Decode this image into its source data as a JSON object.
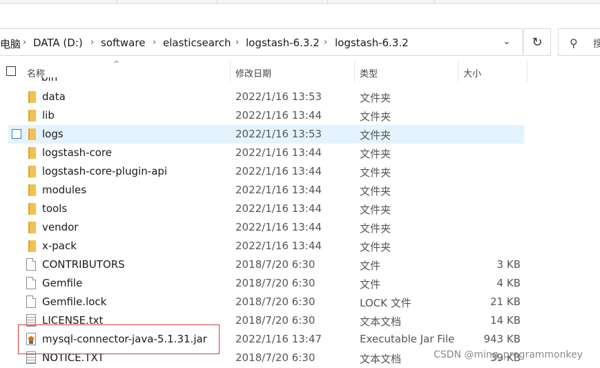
{
  "address_bar": {
    "crumbs": [
      "电脑",
      "DATA (D:)",
      "software",
      "elasticsearch",
      "logstash-6.3.2",
      "logstash-6.3.2"
    ],
    "separator": "›",
    "dropdown_icon": "chevron-down-icon"
  },
  "refresh": {
    "icon": "refresh-icon",
    "glyph": "↻"
  },
  "search": {
    "icon": "search-icon",
    "glyph": "⚲",
    "placeholder": "搜"
  },
  "columns": {
    "name": "名称",
    "date": "修改日期",
    "type": "类型",
    "size": "大小",
    "sort_glyph": "^"
  },
  "partial_row_name": "bin",
  "files": [
    {
      "name": "data",
      "date": "2022/1/16 13:53",
      "type": "文件夹",
      "size": "",
      "icon": "folder-icon"
    },
    {
      "name": "lib",
      "date": "2022/1/16 13:44",
      "type": "文件夹",
      "size": "",
      "icon": "folder-icon"
    },
    {
      "name": "logs",
      "date": "2022/1/16 13:53",
      "type": "文件夹",
      "size": "",
      "icon": "folder-icon",
      "selected": true
    },
    {
      "name": "logstash-core",
      "date": "2022/1/16 13:44",
      "type": "文件夹",
      "size": "",
      "icon": "folder-icon"
    },
    {
      "name": "logstash-core-plugin-api",
      "date": "2022/1/16 13:44",
      "type": "文件夹",
      "size": "",
      "icon": "folder-icon"
    },
    {
      "name": "modules",
      "date": "2022/1/16 13:44",
      "type": "文件夹",
      "size": "",
      "icon": "folder-icon"
    },
    {
      "name": "tools",
      "date": "2022/1/16 13:44",
      "type": "文件夹",
      "size": "",
      "icon": "folder-icon"
    },
    {
      "name": "vendor",
      "date": "2022/1/16 13:44",
      "type": "文件夹",
      "size": "",
      "icon": "folder-icon"
    },
    {
      "name": "x-pack",
      "date": "2022/1/16 13:44",
      "type": "文件夹",
      "size": "",
      "icon": "folder-icon"
    },
    {
      "name": "CONTRIBUTORS",
      "date": "2018/7/20 6:30",
      "type": "文件",
      "size": "3 KB",
      "icon": "file-icon"
    },
    {
      "name": "Gemfile",
      "date": "2018/7/20 6:30",
      "type": "文件",
      "size": "4 KB",
      "icon": "file-icon"
    },
    {
      "name": "Gemfile.lock",
      "date": "2018/7/20 6:30",
      "type": "LOCK 文件",
      "size": "21 KB",
      "icon": "file-icon"
    },
    {
      "name": "LICENSE.txt",
      "date": "2018/7/20 6:30",
      "type": "文本文档",
      "size": "14 KB",
      "icon": "text-file-icon"
    },
    {
      "name": "mysql-connector-java-5.1.31.jar",
      "date": "2022/1/16 13:47",
      "type": "Executable Jar File",
      "size": "943 KB",
      "icon": "java-jar-icon"
    },
    {
      "name": "NOTICE.TXT",
      "date": "2018/7/20 6:30",
      "type": "文本文档",
      "size": "39 KB",
      "icon": "text-file-icon"
    }
  ],
  "watermark": "CSDN @ming_programmonkey",
  "colors": {
    "selection": "#e5f3ff",
    "highlight_border": "#d23a3a",
    "folder": "#f2c14e"
  }
}
